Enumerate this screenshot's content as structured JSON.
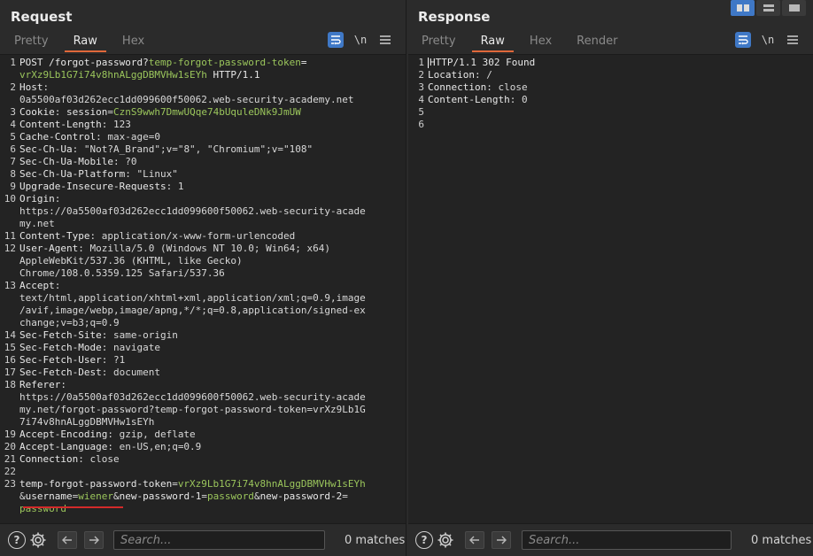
{
  "request": {
    "title": "Request",
    "tabs": [
      "Pretty",
      "Raw",
      "Hex"
    ],
    "active_tab": "Raw",
    "icons": [
      "wrap-lines-icon",
      "newline-icon",
      "menu-icon"
    ],
    "newline_label": "\\n",
    "lines": [
      {
        "n": "1",
        "segs": [
          [
            "k",
            "POST /forgot-password?"
          ],
          [
            "g",
            "temp-forgot-password-token"
          ],
          [
            "k",
            "="
          ]
        ]
      },
      {
        "n": "",
        "segs": [
          [
            "g",
            "vrXz9Lb1G7i74v8hnALggDBMVHw1sEYh"
          ],
          [
            "k",
            " HTTP/1.1"
          ]
        ]
      },
      {
        "n": "2",
        "segs": [
          [
            "k",
            "Host"
          ],
          [
            "v",
            ":"
          ]
        ]
      },
      {
        "n": "",
        "segs": [
          [
            "v",
            "0a5500af03d262ecc1dd099600f50062.web-security-academy.net"
          ]
        ]
      },
      {
        "n": "3",
        "segs": [
          [
            "k",
            "Cookie"
          ],
          [
            "v",
            ": "
          ],
          [
            "k",
            "session"
          ],
          [
            "v",
            "="
          ],
          [
            "g",
            "CznS9wwh7DmwUQqe74bUquleDNk9JmUW"
          ]
        ]
      },
      {
        "n": "4",
        "segs": [
          [
            "k",
            "Content-Length"
          ],
          [
            "v",
            ": 123"
          ]
        ]
      },
      {
        "n": "5",
        "segs": [
          [
            "k",
            "Cache-Control"
          ],
          [
            "v",
            ": max-age=0"
          ]
        ]
      },
      {
        "n": "6",
        "segs": [
          [
            "k",
            "Sec-Ch-Ua"
          ],
          [
            "v",
            ": \"Not?A_Brand\";v=\"8\", \"Chromium\";v=\"108\""
          ]
        ]
      },
      {
        "n": "7",
        "segs": [
          [
            "k",
            "Sec-Ch-Ua-Mobile"
          ],
          [
            "v",
            ": ?0"
          ]
        ]
      },
      {
        "n": "8",
        "segs": [
          [
            "k",
            "Sec-Ch-Ua-Platform"
          ],
          [
            "v",
            ": \"Linux\""
          ]
        ]
      },
      {
        "n": "9",
        "segs": [
          [
            "k",
            "Upgrade-Insecure-Requests"
          ],
          [
            "v",
            ": 1"
          ]
        ]
      },
      {
        "n": "10",
        "segs": [
          [
            "k",
            "Origin"
          ],
          [
            "v",
            ":"
          ]
        ]
      },
      {
        "n": "",
        "segs": [
          [
            "v",
            "https://0a5500af03d262ecc1dd099600f50062.web-security-acade"
          ]
        ]
      },
      {
        "n": "",
        "segs": [
          [
            "v",
            "my.net"
          ]
        ]
      },
      {
        "n": "11",
        "segs": [
          [
            "k",
            "Content-Type"
          ],
          [
            "v",
            ": application/x-www-form-urlencoded"
          ]
        ]
      },
      {
        "n": "12",
        "segs": [
          [
            "k",
            "User-Agent"
          ],
          [
            "v",
            ": Mozilla/5.0 (Windows NT 10.0; Win64; x64)"
          ]
        ]
      },
      {
        "n": "",
        "segs": [
          [
            "v",
            "AppleWebKit/537.36 (KHTML, like Gecko)"
          ]
        ]
      },
      {
        "n": "",
        "segs": [
          [
            "v",
            "Chrome/108.0.5359.125 Safari/537.36"
          ]
        ]
      },
      {
        "n": "13",
        "segs": [
          [
            "k",
            "Accept"
          ],
          [
            "v",
            ":"
          ]
        ]
      },
      {
        "n": "",
        "segs": [
          [
            "v",
            "text/html,application/xhtml+xml,application/xml;q=0.9,image"
          ]
        ]
      },
      {
        "n": "",
        "segs": [
          [
            "v",
            "/avif,image/webp,image/apng,*/*;q=0.8,application/signed-ex"
          ]
        ]
      },
      {
        "n": "",
        "segs": [
          [
            "v",
            "change;v=b3;q=0.9"
          ]
        ]
      },
      {
        "n": "14",
        "segs": [
          [
            "k",
            "Sec-Fetch-Site"
          ],
          [
            "v",
            ": same-origin"
          ]
        ]
      },
      {
        "n": "15",
        "segs": [
          [
            "k",
            "Sec-Fetch-Mode"
          ],
          [
            "v",
            ": navigate"
          ]
        ]
      },
      {
        "n": "16",
        "segs": [
          [
            "k",
            "Sec-Fetch-User"
          ],
          [
            "v",
            ": ?1"
          ]
        ]
      },
      {
        "n": "17",
        "segs": [
          [
            "k",
            "Sec-Fetch-Dest"
          ],
          [
            "v",
            ": document"
          ]
        ]
      },
      {
        "n": "18",
        "segs": [
          [
            "k",
            "Referer"
          ],
          [
            "v",
            ":"
          ]
        ]
      },
      {
        "n": "",
        "segs": [
          [
            "v",
            "https://0a5500af03d262ecc1dd099600f50062.web-security-acade"
          ]
        ]
      },
      {
        "n": "",
        "segs": [
          [
            "v",
            "my.net/forgot-password?temp-forgot-password-token=vrXz9Lb1G"
          ]
        ]
      },
      {
        "n": "",
        "segs": [
          [
            "v",
            "7i74v8hnALggDBMVHw1sEYh"
          ]
        ]
      },
      {
        "n": "19",
        "segs": [
          [
            "k",
            "Accept-Encoding"
          ],
          [
            "v",
            ": gzip, deflate"
          ]
        ]
      },
      {
        "n": "20",
        "segs": [
          [
            "k",
            "Accept-Language"
          ],
          [
            "v",
            ": en-US,en;q=0.9"
          ]
        ]
      },
      {
        "n": "21",
        "segs": [
          [
            "k",
            "Connection"
          ],
          [
            "v",
            ": close"
          ]
        ]
      },
      {
        "n": "22",
        "segs": []
      },
      {
        "n": "23",
        "segs": [
          [
            "k",
            "temp-forgot-password-token"
          ],
          [
            "v",
            "="
          ],
          [
            "g",
            "vrXz9Lb1G7i74v8hnALggDBMVHw1sEYh"
          ]
        ]
      },
      {
        "n": "",
        "segs": [
          [
            "v",
            "&"
          ],
          [
            "k",
            "username"
          ],
          [
            "v",
            "="
          ],
          [
            "g",
            "wiener"
          ],
          [
            "v",
            "&"
          ],
          [
            "k",
            "new-password-1"
          ],
          [
            "v",
            "="
          ],
          [
            "g",
            "password"
          ],
          [
            "v",
            "&"
          ],
          [
            "k",
            "new-password-2"
          ],
          [
            "v",
            "="
          ]
        ]
      },
      {
        "n": "",
        "segs": [
          [
            "g",
            "password"
          ]
        ]
      }
    ],
    "search_placeholder": "Search...",
    "matches": "0 matches"
  },
  "response": {
    "title": "Response",
    "tabs": [
      "Pretty",
      "Raw",
      "Hex",
      "Render"
    ],
    "active_tab": "Raw",
    "newline_label": "\\n",
    "lines": [
      {
        "n": "1",
        "segs": [
          [
            "k",
            "HTTP/1.1 302 Found"
          ]
        ]
      },
      {
        "n": "2",
        "segs": [
          [
            "k",
            "Location"
          ],
          [
            "v",
            ": /"
          ]
        ]
      },
      {
        "n": "3",
        "segs": [
          [
            "k",
            "Connection"
          ],
          [
            "v",
            ": close"
          ]
        ]
      },
      {
        "n": "4",
        "segs": [
          [
            "k",
            "Content-Length"
          ],
          [
            "v",
            ": 0"
          ]
        ]
      },
      {
        "n": "5",
        "segs": []
      },
      {
        "n": "6",
        "segs": []
      }
    ],
    "search_placeholder": "Search...",
    "matches": "0 matches"
  },
  "colors": {
    "accent_blue": "#3f78c6",
    "tab_underline": "#e0683a",
    "value_green": "#9bc65c",
    "highlight_red": "#d32a2a"
  }
}
